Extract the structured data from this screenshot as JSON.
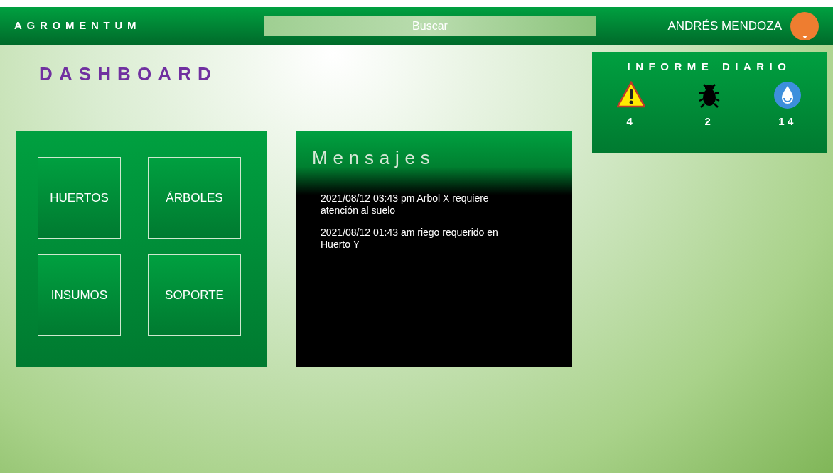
{
  "header": {
    "brand": "AGROMENTUM",
    "search": {
      "placeholder": "Buscar"
    },
    "user": "ANDRÉS MENDOZA"
  },
  "page_title": "DASHBOARD",
  "menu": [
    {
      "label": "HUERTOS"
    },
    {
      "label": "ÁRBOLES"
    },
    {
      "label": "INSUMOS"
    },
    {
      "label": "SOPORTE"
    }
  ],
  "messages": {
    "title": "Mensajes",
    "items": [
      "2021/08/12 03:43 pm Arbol X requiere atención al suelo",
      "2021/08/12 01:43 am riego requerido en Huerto Y"
    ]
  },
  "daily_report": {
    "title": "INFORME DIARIO",
    "items": [
      {
        "kind": "warning",
        "count": "4"
      },
      {
        "kind": "pest",
        "count": "2"
      },
      {
        "kind": "water",
        "count": "14"
      }
    ]
  }
}
